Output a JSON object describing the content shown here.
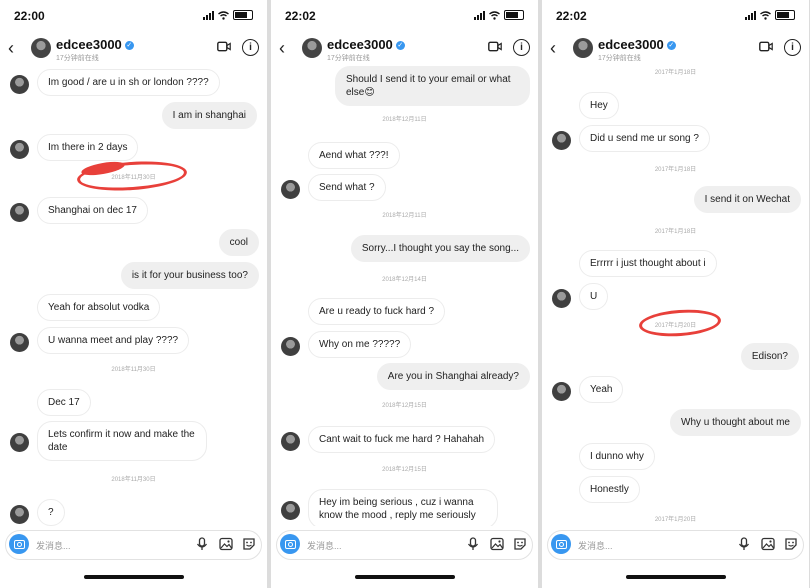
{
  "panels": [
    {
      "status_time": "22:00",
      "contact": {
        "name": "edcee3000",
        "subtitle": "17分钟前在线"
      },
      "composer": {
        "placeholder": "发消息..."
      },
      "items": [
        {
          "kind": "in",
          "text": "Im good / are u in sh or london ????",
          "avatar": true
        },
        {
          "kind": "out",
          "text": "I am in shanghai"
        },
        {
          "kind": "in",
          "text": "Im there in 2 days",
          "avatar": true
        },
        {
          "kind": "ts",
          "text": "2018年11月30日",
          "circled": true
        },
        {
          "kind": "in",
          "text": "Shanghai on dec 17",
          "avatar": true
        },
        {
          "kind": "out",
          "text": "cool"
        },
        {
          "kind": "out",
          "text": "is it for your business too?"
        },
        {
          "kind": "in",
          "text": "Yeah for absolut vodka"
        },
        {
          "kind": "in",
          "text": "U wanna meet and play ????",
          "avatar": true
        },
        {
          "kind": "ts",
          "text": "2018年11月30日"
        },
        {
          "kind": "in",
          "text": "Dec 17"
        },
        {
          "kind": "in",
          "text": "Lets confirm it now and make the date",
          "avatar": true,
          "lines": 2
        },
        {
          "kind": "ts",
          "text": "2018年11月30日"
        },
        {
          "kind": "in",
          "text": "?",
          "avatar": true
        }
      ]
    },
    {
      "status_time": "22:02",
      "contact": {
        "name": "edcee3000",
        "subtitle": "17分钟前在线"
      },
      "composer": {
        "placeholder": "发消息..."
      },
      "items": [
        {
          "kind": "out",
          "text": "Should I send it to your email or what else😊",
          "lines": 2
        },
        {
          "kind": "ts",
          "text": "2018年12月11日"
        },
        {
          "kind": "in",
          "text": "Aend what ???!"
        },
        {
          "kind": "in",
          "text": "Send what ?",
          "avatar": true
        },
        {
          "kind": "ts",
          "text": "2018年12月11日"
        },
        {
          "kind": "out",
          "text": "Sorry...I thought you say the song..."
        },
        {
          "kind": "ts",
          "text": "2018年12月14日"
        },
        {
          "kind": "in",
          "text": "Are u ready to fuck hard ?"
        },
        {
          "kind": "in",
          "text": "Why on me ?????",
          "avatar": true
        },
        {
          "kind": "out",
          "text": "Are you in Shanghai already?"
        },
        {
          "kind": "ts",
          "text": "2018年12月15日"
        },
        {
          "kind": "in",
          "text": "Cant wait to fuck me hard ? Hahahah",
          "avatar": true
        },
        {
          "kind": "ts",
          "text": "2018年12月15日"
        },
        {
          "kind": "in",
          "text": "Hey im being serious , cuz i wanna know the mood , reply me seriously",
          "avatar": true,
          "lines": 2
        }
      ]
    },
    {
      "status_time": "22:02",
      "contact": {
        "name": "edcee3000",
        "subtitle": "17分钟前在线"
      },
      "composer": {
        "placeholder": "发消息..."
      },
      "items": [
        {
          "kind": "ts",
          "text": "2017年1月18日"
        },
        {
          "kind": "in",
          "text": "Hey"
        },
        {
          "kind": "in",
          "text": "Did u send me ur song ?",
          "avatar": true
        },
        {
          "kind": "ts",
          "text": "2017年1月18日"
        },
        {
          "kind": "out",
          "text": "I send it on Wechat"
        },
        {
          "kind": "ts",
          "text": "2017年1月18日"
        },
        {
          "kind": "in",
          "text": "Errrrr i just thought about i"
        },
        {
          "kind": "in",
          "text": "U",
          "avatar": true
        },
        {
          "kind": "ts",
          "text": "2017年1月20日",
          "circled": true
        },
        {
          "kind": "out",
          "text": "Edison?"
        },
        {
          "kind": "in",
          "text": "Yeah",
          "avatar": true
        },
        {
          "kind": "out",
          "text": "Why u thought about me"
        },
        {
          "kind": "in",
          "text": "I dunno why"
        },
        {
          "kind": "in",
          "text": "Honestly"
        },
        {
          "kind": "ts",
          "text": "2017年1月20日"
        }
      ]
    }
  ]
}
